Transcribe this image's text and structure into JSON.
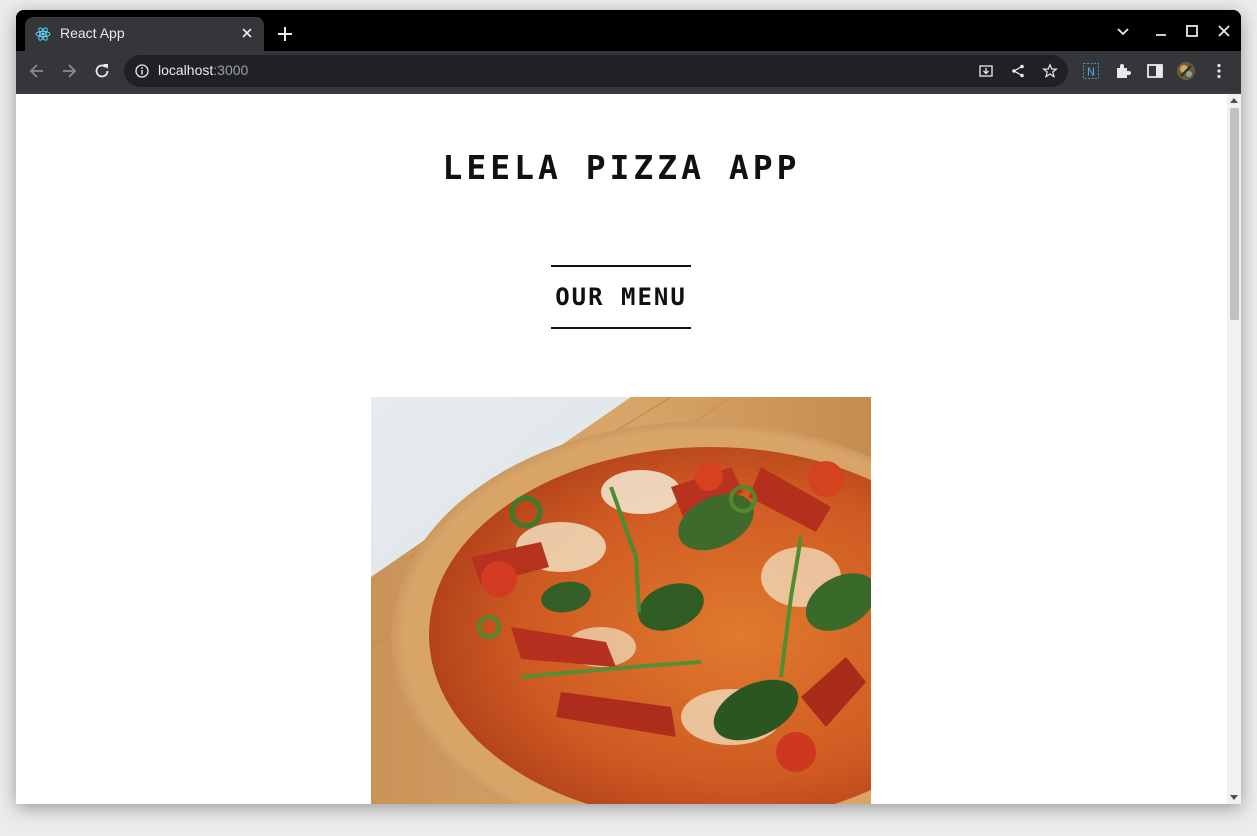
{
  "browser": {
    "tab_title": "React App",
    "url_host": "localhost",
    "url_port": ":3000"
  },
  "page": {
    "app_title": "LEELA PIZZA APP",
    "menu_heading": "OUR MENU"
  },
  "colors": {
    "tab_active": "#35363a",
    "omnibox": "#202124",
    "page_bg": "#ffffff",
    "text": "#111111"
  },
  "icons": {
    "tab_favicon": "react-icon",
    "extension_1": "extension-n-icon",
    "extensions": "puzzle-icon",
    "side_panel": "side-panel-icon",
    "profile": "avatar"
  }
}
